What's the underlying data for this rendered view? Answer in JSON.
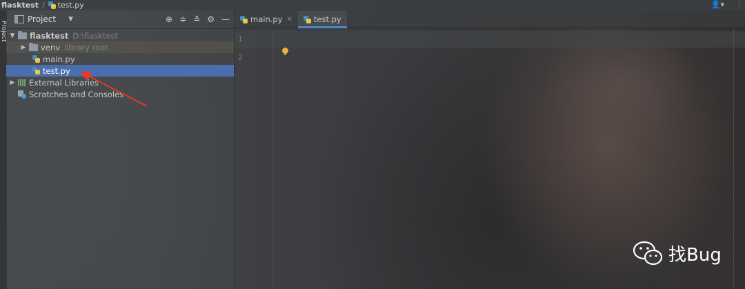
{
  "topbar": {
    "root": "flasktest",
    "separator": "/",
    "file": "test.py",
    "user_glyph": "👤▾"
  },
  "strip": {
    "label": "Project"
  },
  "panel": {
    "title": "Project",
    "tool_icons": [
      "crosshair-icon",
      "collapse-all-icon",
      "expand-icon",
      "gear-icon",
      "minimize-icon"
    ]
  },
  "tree": {
    "root": {
      "name": "flasktest",
      "path": "D:\\flasktest"
    },
    "venv": {
      "name": "venv",
      "note": "library root"
    },
    "files": [
      {
        "name": "main.py",
        "selected": false
      },
      {
        "name": "test.py",
        "selected": true
      }
    ],
    "external": "External Libraries",
    "scratches": "Scratches and Consoles"
  },
  "editor": {
    "tabs": [
      {
        "label": "main.py",
        "active": false
      },
      {
        "label": "test.py",
        "active": true
      }
    ],
    "line_numbers": [
      "1",
      "2"
    ]
  },
  "watermark": {
    "text": "找Bug"
  },
  "colors": {
    "selection": "#4b6eaf",
    "tab_underline": "#4a88c7",
    "annotation_arrow": "#e8382a",
    "bulb": "#f1b13c"
  }
}
